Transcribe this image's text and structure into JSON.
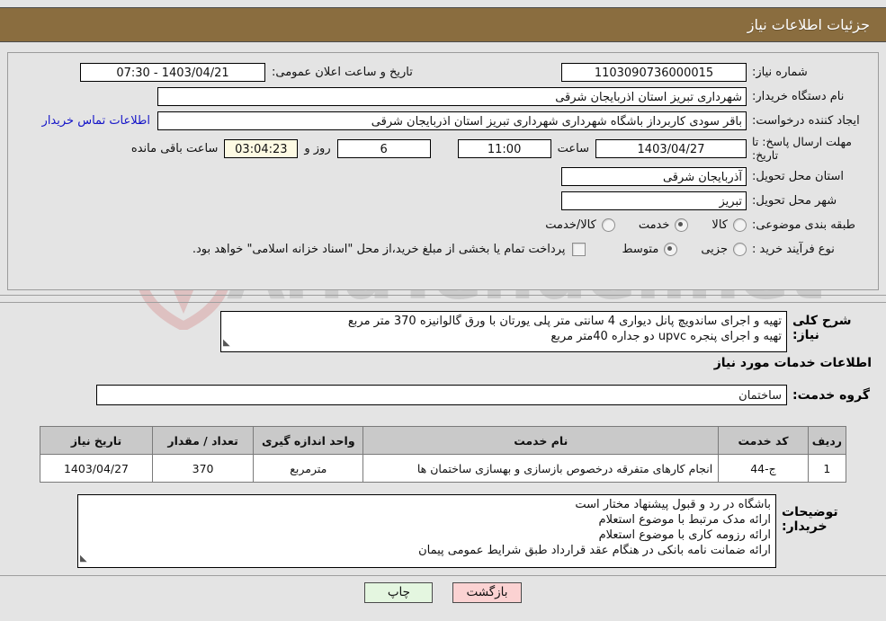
{
  "header": {
    "title": "جزئیات اطلاعات نیاز",
    "bar_color": "#8a6d3f"
  },
  "watermark": {
    "text": "AriaTender.net",
    "shield_color": "#e8c9c9"
  },
  "form": {
    "need_number": {
      "label": "شماره نیاز:",
      "value": "1103090736000015"
    },
    "public_announce": {
      "label": "تاریخ و ساعت اعلان عمومی:",
      "value": "1403/04/21 - 07:30"
    },
    "buyer_org": {
      "label": "نام دستگاه خریدار:",
      "value": "شهرداری تبریز استان اذربایجان شرقی"
    },
    "requester": {
      "label": "ایجاد کننده درخواست:",
      "value": "باقر سودی کاربرداز باشگاه  شهرداری  شهرداری تبریز استان اذربایجان شرقی",
      "contact_link": "اطلاعات تماس خریدار"
    },
    "deadline": {
      "label": "مهلت ارسال پاسخ: تا تاریخ:",
      "date": "1403/04/27",
      "time_label": "ساعت",
      "time": "11:00",
      "days": "6",
      "days_label": "روز و",
      "countdown": "03:04:23",
      "remaining_label": "ساعت باقی مانده"
    },
    "province": {
      "label": "استان محل تحویل:",
      "value": "آذربایجان شرقی"
    },
    "city": {
      "label": "شهر محل تحویل:",
      "value": "تبریز"
    },
    "category": {
      "label": "طبقه بندی موضوعی:",
      "options": [
        {
          "label": "کالا",
          "selected": false
        },
        {
          "label": "خدمت",
          "selected": true
        },
        {
          "label": "کالا/خدمت",
          "selected": false
        }
      ]
    },
    "purchase_type": {
      "label": "نوع فرآیند خرید :",
      "options": [
        {
          "label": "جزیی",
          "selected": false
        },
        {
          "label": "متوسط",
          "selected": true
        }
      ],
      "note": "پرداخت تمام یا بخشی از مبلغ خرید،از محل \"اسناد خزانه اسلامی\" خواهد بود.",
      "note_checked": false
    }
  },
  "description": {
    "label": "شرح کلی نیاز:",
    "lines": [
      "تهیه و اجرای ساندویچ پانل دیواری 4 سانتی متر پلی یورتان با ورق گالوانیزه 370 متر مربع",
      "تهیه و اجرای پنجره upvc  دو جداره 40متر مربع"
    ]
  },
  "services_section": {
    "title": "اطلاعات خدمات مورد نیاز",
    "service_group": {
      "label": "گروه خدمت:",
      "value": "ساختمان"
    },
    "table": {
      "columns": [
        "ردیف",
        "کد خدمت",
        "نام خدمت",
        "واحد اندازه گیری",
        "تعداد / مقدار",
        "تاریخ نیاز"
      ],
      "rows": [
        {
          "radif": "1",
          "code": "ج-44",
          "name": "انجام کارهای متفرقه درخصوص بازسازی و بهسازی ساختمان ها",
          "unit": "مترمربع",
          "quantity": "370",
          "date": "1403/04/27"
        }
      ]
    }
  },
  "buyer_notes": {
    "label": "توضیحات خریدار:",
    "lines": [
      "باشگاه در رد و قبول پیشنهاد مختار است",
      "ارائه مدک مرتبط با موضوع استعلام",
      "ارائه رزومه کاری با موضوع استعلام",
      "ارائه ضمانت نامه بانکی در هنگام عقد قرارداد طبق شرایط عمومی پیمان"
    ]
  },
  "buttons": {
    "back": "بازگشت",
    "print": "چاپ"
  }
}
